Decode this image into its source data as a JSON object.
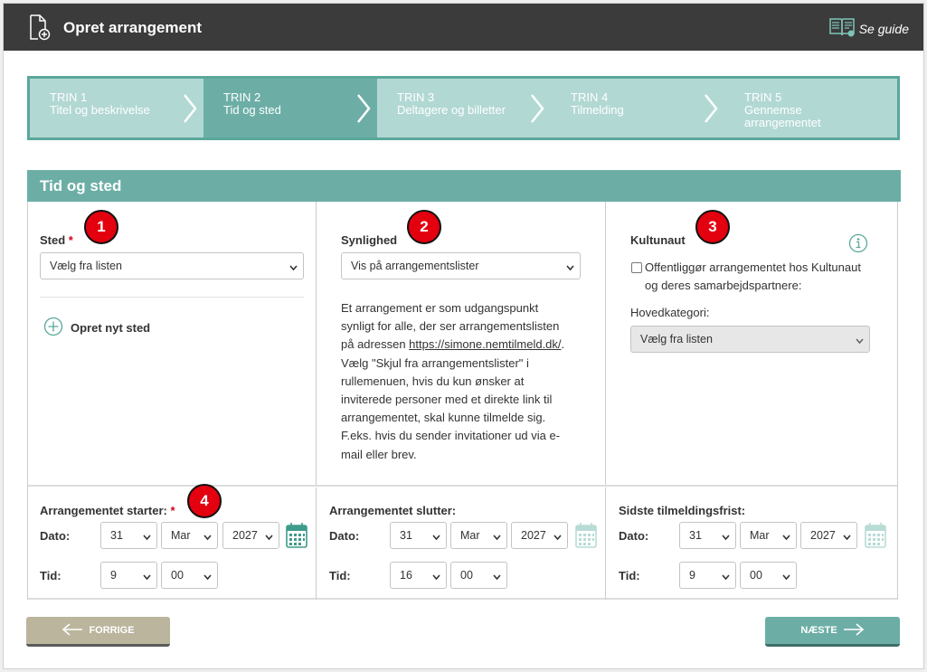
{
  "header": {
    "title": "Opret arrangement",
    "guide_label": "Se guide"
  },
  "steps": [
    {
      "num": "TRIN 1",
      "label": "Titel og beskrivelse"
    },
    {
      "num": "TRIN 2",
      "label": "Tid og sted"
    },
    {
      "num": "TRIN 3",
      "label": "Deltagere og billetter"
    },
    {
      "num": "TRIN 4",
      "label": "Tilmelding"
    },
    {
      "num": "TRIN 5",
      "label": "Gennemse arrangementet"
    }
  ],
  "section_title": "Tid og sted",
  "sted": {
    "label": "Sted",
    "required": "*",
    "select_value": "Vælg fra listen",
    "add_label": "Opret nyt sted"
  },
  "synlighed": {
    "label": "Synlighed",
    "select_value": "Vis på arrangementslister",
    "desc_before": "Et arrangement er som udgangspunkt synligt for alle, der ser arrangementslisten på adressen ",
    "desc_link": "https://simone.nemtilmeld.dk/",
    "desc_after": ". Vælg \"Skjul fra arrangementslister\" i rullemenuen, hvis du kun ønsker at inviterede personer med et direkte link til arrangementet, skal kunne tilmelde sig. F.eks. hvis du sender invitationer ud via e-mail eller brev."
  },
  "kultunaut": {
    "label": "Kultunaut",
    "checkbox_label": "Offentliggør arrangementet hos Kultunaut og deres samarbejdspartnere:",
    "category_label": "Hovedkategori:",
    "category_value": "Vælg fra listen"
  },
  "badges": [
    "1",
    "2",
    "3",
    "4"
  ],
  "date_label": "Dato:",
  "time_label": "Tid:",
  "start": {
    "label": "Arrangementet starter:",
    "required": "*",
    "day": "31",
    "month": "Mar",
    "year": "2027",
    "hour": "9",
    "minute": "00"
  },
  "end": {
    "label": "Arrangementet slutter:",
    "day": "31",
    "month": "Mar",
    "year": "2027",
    "hour": "16",
    "minute": "00"
  },
  "deadline": {
    "label": "Sidste tilmeldingsfrist:",
    "day": "31",
    "month": "Mar",
    "year": "2027",
    "hour": "9",
    "minute": "00"
  },
  "buttons": {
    "prev": "FORRIGE",
    "next": "NÆSTE"
  },
  "colors": {
    "accent": "#6caea5",
    "topbar": "#3b3b3b",
    "badge": "#e3000f",
    "prev_button": "#bab59c"
  }
}
